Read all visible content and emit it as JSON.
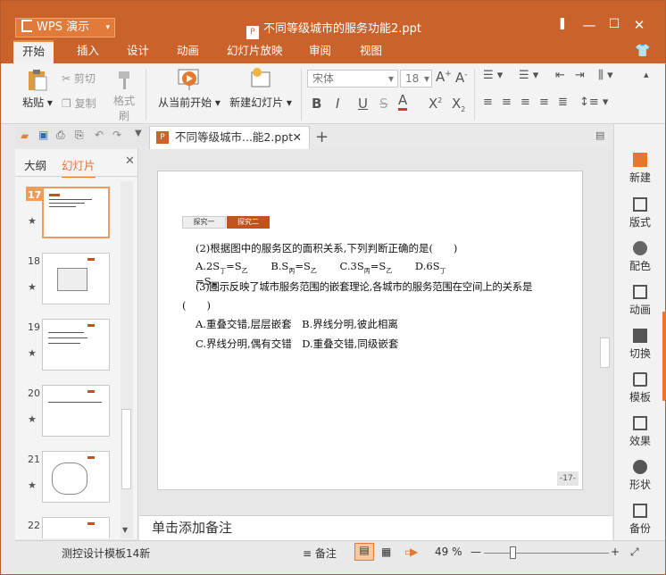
{
  "app": {
    "name": "WPS 演示",
    "document_title": "不同等级城市的服务功能2.ppt"
  },
  "window_controls": {
    "minimize": "—",
    "maximize": "☐",
    "close": "✕"
  },
  "menu_tabs": [
    "开始",
    "插入",
    "设计",
    "动画",
    "幻灯片放映",
    "审阅",
    "视图"
  ],
  "ribbon": {
    "paste": "粘贴",
    "cut": "剪切",
    "copy": "复制",
    "format_painter": "格式刷",
    "from_current": "从当前开始",
    "new_slide": "新建幻灯片",
    "font_name": "宋体",
    "font_size": "18"
  },
  "doc_tab": {
    "label": "不同等级城市...能2.ppt"
  },
  "left_panel": {
    "tab_outline": "大纲",
    "tab_slides": "幻灯片",
    "slides": [
      {
        "num": "17"
      },
      {
        "num": "18"
      },
      {
        "num": "19"
      },
      {
        "num": "20"
      },
      {
        "num": "21"
      },
      {
        "num": "22"
      }
    ]
  },
  "right_sidebar": [
    "新建",
    "版式",
    "配色",
    "动画",
    "切换",
    "模板",
    "效果",
    "形状",
    "备份"
  ],
  "slide": {
    "tab1": "探究一",
    "tab2": "探究二",
    "q2": "(2)根据图中的服务区的面积关系,下列判断正确的是(　　)",
    "q2_opts": {
      "a": "A.2S",
      "a_sub": "丁",
      "a_eq": "=S",
      "a_sub2": "乙",
      "b": "B.S",
      "b_sub": "丙",
      "b_eq": "=S",
      "b_sub2": "乙",
      "c": "C.3S",
      "c_sub": "丙",
      "c_eq": "=S",
      "c_sub2": "乙",
      "d": "D.6S",
      "d_sub": "丁",
      "d_eq": "=S",
      "d_sub2": "丙"
    },
    "q3": "(3)图示反映了城市服务范围的嵌套理论,各城市的服务范围在空间上的关系是",
    "q3_paren": "(　　)",
    "q3_ab": "A.重叠交错,层层嵌套　B.界线分明,彼此相离",
    "q3_cd": "C.界线分明,偶有交错　D.重叠交错,同级嵌套",
    "page": "-17-"
  },
  "notes_placeholder": "单击添加备注",
  "status": {
    "template": "测控设计模板14新",
    "notes": "备注",
    "zoom": "49 %"
  }
}
